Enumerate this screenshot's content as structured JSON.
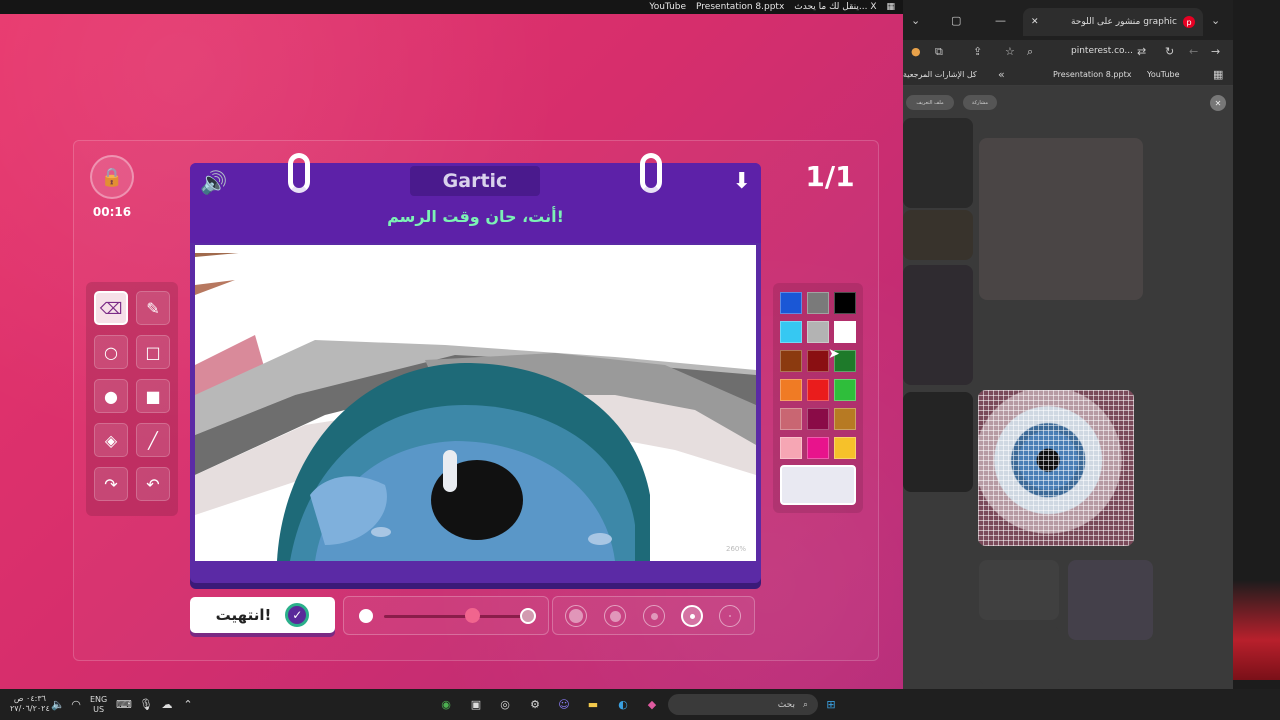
{
  "top_strip": {
    "items": [
      "YouTube",
      "Presentation 8.pptx",
      "ينقل لك ما يحدث... X"
    ]
  },
  "game": {
    "timer": "00:16",
    "counter": "1/1",
    "brand": "Gartic",
    "prompt": "أنت، حان وقت الرسم!",
    "zoom": "260%",
    "done_label": "انتهيت!",
    "brush_level": 0.63,
    "tools": [
      "eraser",
      "pencil",
      "circle-outline",
      "square-outline",
      "circle-fill",
      "square-fill",
      "fill-bucket",
      "line",
      "redo",
      "undo"
    ],
    "palette": [
      "#1a57d6",
      "#7a7a7a",
      "#000000",
      "#36c8f2",
      "#b3b3b3",
      "#ffffff",
      "#8b3a0f",
      "#8a0f12",
      "#1e7a2a",
      "#f07b24",
      "#ea1c1c",
      "#2fbe3b",
      "#c96672",
      "#8a0b47",
      "#b77a23",
      "#f6a6b4",
      "#e8138c",
      "#f6c12a"
    ]
  },
  "browser": {
    "tab_title": "منشور على اللوحة graphic",
    "url": "pinterest.co...",
    "bookmarks": [
      "YouTube",
      "Presentation 8.pptx",
      "كل الإشارات المرجعية"
    ],
    "chip_share": "مشاركة",
    "chip_profile": "ملف التعريف"
  },
  "taskbar": {
    "lang": "ENG",
    "region": "US",
    "search_placeholder": "بحث",
    "clock_time": "٠٤:٣٦ ص",
    "clock_date": "٢٧/٠٦/٢٠٢٤"
  }
}
